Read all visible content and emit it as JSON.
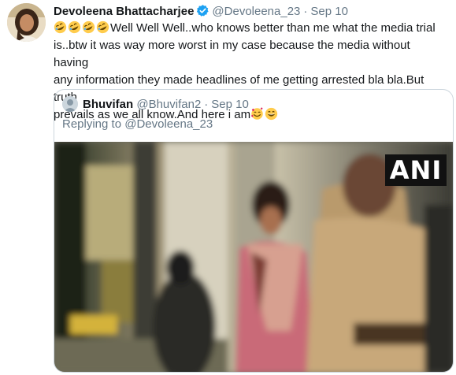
{
  "tweet": {
    "author_name": "Devoleena Bhattacharjee",
    "author_handle": "@Devoleena_23",
    "separator": "·",
    "date": "Sep 10",
    "text_line1": "Well Well Well..who knows better than me what the media trial",
    "text_line2": "is..btw it was way more worst in my case because the media without having",
    "text_line3": "any information they made headlines of me getting arrested bla bla.But truth",
    "text_line4": "prevails as we all know.And here i am",
    "leading_emoji": [
      "rolling-on-floor-laughing",
      "rolling-on-floor-laughing",
      "rolling-on-floor-laughing",
      "rolling-on-floor-laughing"
    ],
    "trailing_emoji": [
      "smiling-face-with-hearts",
      "grinning-face-with-smiling-eyes"
    ]
  },
  "quoted": {
    "author_name": "Bhuvifan",
    "author_handle": "@Bhuvifan2",
    "separator": "·",
    "date": "Sep 10",
    "reply_prefix": "Replying to",
    "reply_to": "@Devoleena_23",
    "media_watermark": "ANI"
  },
  "colors": {
    "verified_blue": "#1da1f2",
    "secondary_text": "#657786",
    "border": "#ccd6dd"
  }
}
